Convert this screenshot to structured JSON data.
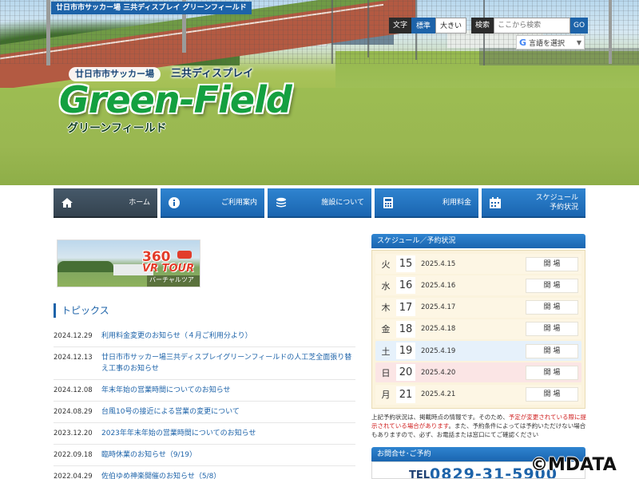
{
  "header": {
    "top_strip": "廿日市市サッカー場 三共ディスプレイ グリーンフィールド",
    "font_size": {
      "label": "文字",
      "options": [
        "標準",
        "大きい"
      ],
      "selected": "標準"
    },
    "search": {
      "label": "検索",
      "placeholder": "ここから検索",
      "go_label": "GO"
    },
    "translate": {
      "icon": "google-g-icon",
      "label": "言語を選択"
    },
    "logo": {
      "sub1": "廿日市市サッカー場",
      "sub2": "三共ディスプレイ",
      "main": "Green-Field",
      "kana": "グリーンフィールド"
    }
  },
  "nav": {
    "items": [
      {
        "label": "ホーム",
        "icon": "home-icon",
        "active": true
      },
      {
        "label": "ご利用案内",
        "icon": "info-icon",
        "active": false
      },
      {
        "label": "施設について",
        "icon": "layers-icon",
        "active": false
      },
      {
        "label": "利用料金",
        "icon": "calculator-icon",
        "active": false
      },
      {
        "label_line1": "スケジュール",
        "label_line2": "予約状況",
        "icon": "calendar-icon",
        "active": false
      }
    ]
  },
  "vr_banner": {
    "num": "360",
    "tour": "VR TOUR",
    "sub": "バーチャルツアー"
  },
  "topics": {
    "title": "トピックス",
    "items": [
      {
        "date": "2024.12.29",
        "title": "利用料金変更のお知らせ（４月ご利用分より）"
      },
      {
        "date": "2024.12.13",
        "title": "廿日市市サッカー場三共ディスプレイグリーンフィールドの人工芝全面張り替え工事のお知らせ"
      },
      {
        "date": "2024.12.08",
        "title": "年末年始の営業時間についてのお知らせ"
      },
      {
        "date": "2024.08.29",
        "title": "台風10号の接近による営業の変更について"
      },
      {
        "date": "2023.12.20",
        "title": "2023年年末年始の営業時間についてのお知らせ"
      },
      {
        "date": "2022.09.18",
        "title": "臨時休業のお知らせ（9/19）"
      },
      {
        "date": "2022.04.29",
        "title": "佐伯ゆめ神楽開催のお知らせ（5/8）"
      }
    ]
  },
  "schedule": {
    "title": "スケジュール／予約状況",
    "rows": [
      {
        "day": "火",
        "num": "15",
        "date": "2025.4.15",
        "status": "開 場",
        "kind": "weekday"
      },
      {
        "day": "水",
        "num": "16",
        "date": "2025.4.16",
        "status": "開 場",
        "kind": "weekday"
      },
      {
        "day": "木",
        "num": "17",
        "date": "2025.4.17",
        "status": "開 場",
        "kind": "weekday"
      },
      {
        "day": "金",
        "num": "18",
        "date": "2025.4.18",
        "status": "開 場",
        "kind": "weekday"
      },
      {
        "day": "土",
        "num": "19",
        "date": "2025.4.19",
        "status": "開 場",
        "kind": "sat"
      },
      {
        "day": "日",
        "num": "20",
        "date": "2025.4.20",
        "status": "開 場",
        "kind": "sun"
      },
      {
        "day": "月",
        "num": "21",
        "date": "2025.4.21",
        "status": "開 場",
        "kind": "weekday"
      }
    ],
    "note_part1": "上記予約状況は、掲載時点の情報です。そのため、",
    "note_red": "予定が変更されている際に提示されている場合があります",
    "note_part2": "。また、予約条件によっては予約いただけない場合もありますので、必ず、お電話または窓口にてご確認ください"
  },
  "contact": {
    "title": "お問合せ･ご予約",
    "tel_label": "TEL",
    "tel": "0829-31-5900"
  },
  "watermark": "©MDATA",
  "colors": {
    "brand_blue": "#1d63a9",
    "logo_green": "#14a040",
    "notice_red": "#d02020"
  }
}
